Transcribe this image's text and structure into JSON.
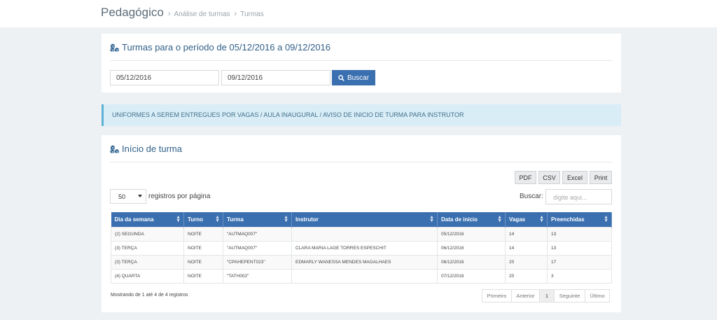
{
  "breadcrumb": {
    "root": "Pedagógico",
    "items": [
      "Análise de turmas",
      "Turmas"
    ]
  },
  "period_panel": {
    "title": "Turmas para o período de 05/12/2016 a 09/12/2016",
    "start_date": "05/12/2016",
    "end_date": "09/12/2016",
    "search_button": "Buscar"
  },
  "alert": {
    "text": "UNIFORMES A SEREM ENTREGUES POR VAGAS / AULA INAUGURAL / AVISO DE INICIO DE TURMA PARA INSTRUTOR"
  },
  "table_panel": {
    "title": "Início de turma",
    "export_buttons": [
      "PDF",
      "CSV",
      "Excel",
      "Print"
    ],
    "page_length": "50",
    "page_length_label": "registros por página",
    "search_label": "Buscar:",
    "search_placeholder": "digite aqui...",
    "columns": [
      "Dia da semana",
      "Turno",
      "Turma",
      "Instrutor",
      "Data de início",
      "Vagas",
      "Preenchidas"
    ],
    "rows": [
      [
        "(2) SEGUNDA",
        "NOITE",
        "\"AUTMAQ007\"",
        "",
        "05/12/2016",
        "14",
        "13"
      ],
      [
        "(3) TERÇA",
        "NOITE",
        "\"AUTMAQ007\"",
        "CLARA MARIA LAGE TORRES ESPESCHIT",
        "06/12/2016",
        "14",
        "13"
      ],
      [
        "(3) TERÇA",
        "NOITE",
        "\"CPAHEPENT023\"",
        "EDMARLY WANESSA MENDES MAGALHAES",
        "06/12/2016",
        "20",
        "17"
      ],
      [
        "(4) QUARTA",
        "NOITE",
        "\"TATH002\"",
        "",
        "07/12/2016",
        "20",
        "3"
      ]
    ],
    "info": "Mostrando de 1 até 4 de 4 registros",
    "pagination": [
      "Primeiro",
      "Anterior",
      "1",
      "Seguinte",
      "Último"
    ],
    "active_page": "1"
  },
  "colors": {
    "primary": "#3a6fb0",
    "title": "#2f5f88",
    "alert_bg": "#d9edf7",
    "background": "#edf1f4"
  }
}
